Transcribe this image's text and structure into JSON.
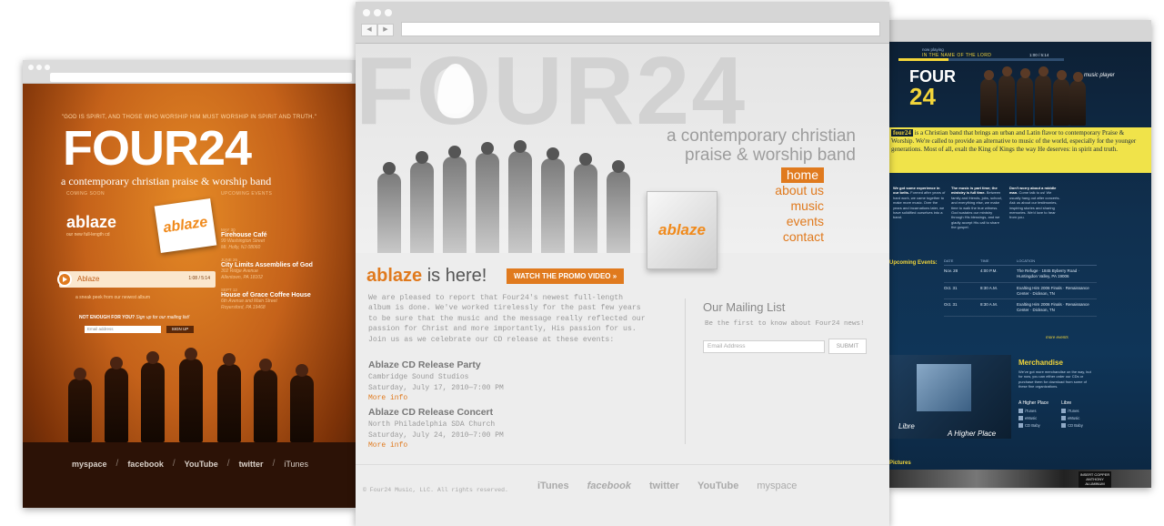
{
  "left_site": {
    "quote": "\"GOD IS SPIRIT, AND THOSE WHO WORSHIP HIM MUST WORSHIP IN SPIRIT AND TRUTH.\"",
    "logo": "FOUR24",
    "tagline": "a contemporary christian praise & worship band",
    "coming_soon": "COMING SOON",
    "upcoming_events": "UPCOMING EVENTS",
    "album": "ablaze",
    "album_sub": "our new full-length cd",
    "cd_label": "ablaze",
    "events": [
      {
        "date": "MAY 30",
        "name": "Firehouse Café",
        "loc1": "99 Washington Street",
        "loc2": "Mt. Holly, NJ 08060"
      },
      {
        "date": "JUNE 26",
        "name": "City Limits Assemblies of God",
        "loc1": "302 Ridge Avenue",
        "loc2": "Allentown, PA 18102"
      },
      {
        "date": "SEPT 12",
        "name": "House of Grace Coffee House",
        "loc1": "6th Avenue and Main Street",
        "loc2": "Royersford, PA 19468"
      }
    ],
    "player_track": "Ablaze",
    "player_time": "1:08 / 5:14",
    "sneak_peek": "a sneak peek from our newest album",
    "not_enough": "NOT ENOUGH FOR YOU?",
    "not_enough_rest": "Sign up for our mailing list!",
    "email_placeholder": "Email address",
    "signup": "SIGN UP",
    "copyright": "© 1999-2009 FOUR24 MUSIC, LLC. FOR AVAILABILITY, PLEASE EMAIL booking@four24.com",
    "social": [
      "myspace",
      "facebook",
      "YouTube",
      "twitter",
      "iTunes"
    ]
  },
  "center_site": {
    "logo": "FOUR24",
    "tagline_1": "a contemporary christian",
    "tagline_2": "praise & worship band",
    "nav": [
      "home",
      "about us",
      "music",
      "events",
      "contact"
    ],
    "cd_label": "ablaze",
    "headline_brand": "ablaze",
    "headline_rest": " is here!",
    "promo": "WATCH THE PROMO VIDEO »",
    "intro": "We are pleased to report that Four24's newest full-length album is done. We've worked tirelessly for the past few years to be sure that the music and the message really reflected our passion for Christ and more importantly, His passion for us. Join us as we celebrate our CD release at these events:",
    "events": [
      {
        "title": "Ablaze CD Release Party",
        "venue": "Cambridge Sound Studios",
        "when": "Saturday, July 17, 2010—7:00 PM",
        "more": "More info"
      },
      {
        "title": "Ablaze CD Release Concert",
        "venue": "North Philadelphia SDA Church",
        "when": "Saturday, July 24, 2010—7:00 PM",
        "more": "More info"
      }
    ],
    "mailing_title": "Our Mailing List",
    "mailing_sub": "Be the first to know about Four24 news!",
    "email_placeholder": "Email Address",
    "submit": "SUBMIT",
    "copyright": "© Four24 Music, LLC. All rights reserved.",
    "social": [
      "iTunes",
      "facebook",
      "twitter",
      "YouTube",
      "myspace"
    ]
  },
  "right_site": {
    "now_playing": "now playing",
    "song": "IN THE NAME OF THE LORD",
    "time": "1:00 / 5:14",
    "logo_top": "FOUR",
    "logo_bottom": "24",
    "music_player": "music player",
    "intro_brand": "four24",
    "intro": " is a Christian band that brings an urban and Latin flavor to contemporary Praise & Worship. We're called to provide an alternative to music of the world, especially for the younger generations. Most of all, exalt the King of Kings the way He deserves: in spirit and truth.",
    "cols": [
      {
        "lead": "We got some experience in our belts.",
        "body": "Formed after years of hard work, we came together to make more music. Over the years and incarnations later, we have solidified ourselves into a band."
      },
      {
        "lead": "The music is part time; the ministry is full time.",
        "body": "Between family and friends, jobs, school, and everything else, we make time to walk the true witness. God sustains our ministry through His blessings, and we gladly accept His call to share the gospel."
      },
      {
        "lead": "Don't worry about a middle man.",
        "body": "Come talk to us! We usually hang out after concerts. Ask us about our testimonies, inspiring stories and sharing memories. We'd love to hear from you."
      }
    ],
    "upcoming": "Upcoming Events:",
    "table_head": [
      "DATE",
      "TIME",
      "LOCATION"
    ],
    "table_rows": [
      {
        "date": "Nov. 28",
        "time": "4:00 P.M.",
        "loc": "The Refuge · 1845 Byberry Road · Huntingdon Valley, PA 19006"
      },
      {
        "date": "Oct. 31",
        "time": "8:30 A.M.",
        "loc": "Exalting Him 2006 Finals · Renaissance Center · Dickson, TN"
      },
      {
        "date": "Oct. 31",
        "time": "8:30 A.M.",
        "loc": "Exalting Him 2006 Finals · Renaissance Center · Dickson, TN"
      }
    ],
    "more_events": "more events",
    "cd_label_1": "Libre",
    "cd_label_2": "A Higher Place",
    "merch_title": "Merchandise",
    "merch_text": "We've got more merchandise on the way, but for now, you can either order our CDs or purchase them for download from some of these fine organizations.",
    "store_col_1": "A Higher Place",
    "store_col_2": "Libre",
    "stores_1": [
      "iTunes",
      "eMusic",
      "CD Baby"
    ],
    "stores_2": [
      "iTunes",
      "eMusic",
      "CD Baby"
    ],
    "pictures": "Pictures",
    "sign": "INSERT COPPER ANTHONY ALUMINUM"
  }
}
